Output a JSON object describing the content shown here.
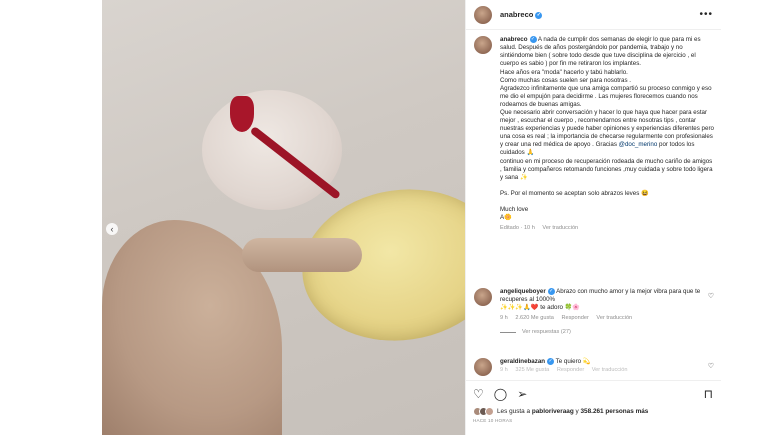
{
  "post": {
    "username": "anabreco",
    "more": "•••"
  },
  "caption": {
    "username": "anabreco",
    "text": "A nada de cumplir dos semanas de elegir lo que para mi es salud. Después de años postergándolo por pandemia, trabajo y no sintiéndome bien ( sobre todo desde que tuve disciplina de ejercicio , el cuerpo es sabio ) por fin me retiraron los implantes.\nHace años era \"moda\" hacerlo y tabú hablarlo.\nComo muchas cosas suelen ser para nosotras .\nAgradezco infinitamente que una amiga compartió su proceso conmigo y eso me dio el empujón para decidirme . Las mujeres florecemos cuando nos rodeamos de buenas amigas.\nQue necesario abrir conversación y hacer lo que haya que hacer para estar mejor , escuchar el cuerpo , recomendarnos entre nosotras tips , contar nuestras experiencias y puede haber opiniones y experiencias diferentes pero una cosa es real ; la importancia de checarse regularmente con profesionales y crear una red médica de apoyo . Gracias",
    "mention": "@doc_merino",
    "text2": " por todos los cuidados 🙏\ncontinuo en mi proceso de recuperación rodeada de mucho cariño de amigos , familia y compañeros retomando funciones ,muy cuidada y sobre todo ligera y sana ✨\n\nPs. Por el momento se aceptan solo abrazos leves 😆\n\nMuch love\nA🌼",
    "edited": "Editado · 10 h",
    "translate": "Ver traducción"
  },
  "comments": [
    {
      "username": "angeliqueboyer",
      "text": "Abrazo con mucho amor y la mejor vibra para que te recuperes al 1000%",
      "text2": "✨✨✨🙏❤️ te adoro 🍀🌸",
      "time": "9 h",
      "likes": "2.620 Me gusta",
      "reply": "Responder",
      "translate": "Ver traducción",
      "replies": "Ver respuestas (27)"
    },
    {
      "username": "geraldinebazan",
      "text": "Te quiero 💫",
      "time": "9 h",
      "likes": "325 Me gusta",
      "reply": "Responder",
      "translate": "Ver traducción"
    }
  ],
  "actions": {
    "like_icon": "heart-icon",
    "comment_icon": "comment-icon",
    "share_icon": "share-icon",
    "save_icon": "bookmark-icon"
  },
  "likes": {
    "text_prefix": "Les gusta a ",
    "user": "pabloriveraag",
    "text_mid": " y ",
    "count": "358.261 personas más"
  },
  "ago": "HACE 10 HORAS"
}
